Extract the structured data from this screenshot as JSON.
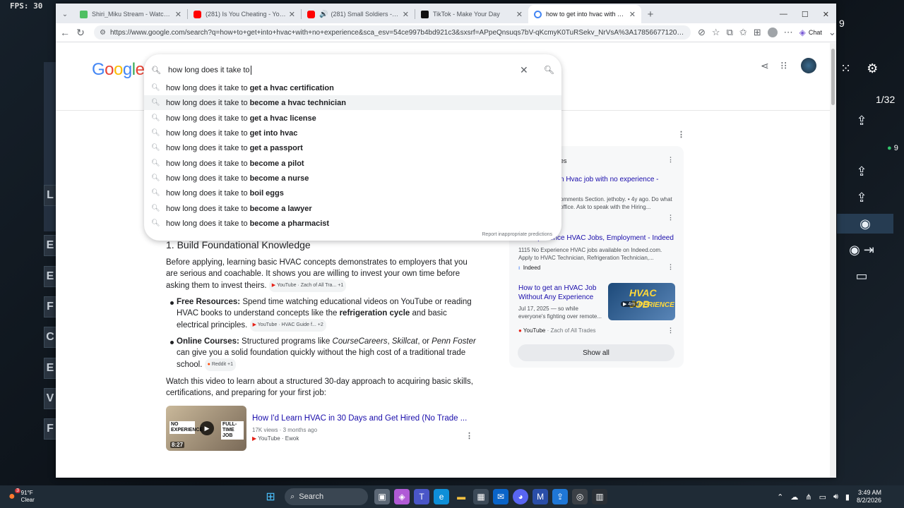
{
  "overlay": {
    "fps_label": "FPS:",
    "fps_value": "30"
  },
  "desktop": {
    "left_tiles": [
      "L",
      "E",
      "E",
      "F",
      "C",
      "E",
      "V",
      "F"
    ],
    "right_counter": "1/32",
    "right_badge": "9",
    "top_right_num": "9"
  },
  "browser": {
    "tabs": [
      {
        "title": "Shiri_Miku Stream - Watch Live on",
        "color": "#4fbf62"
      },
      {
        "title": "(281) Is You Cheating - YouTube",
        "color": "#ff0000"
      },
      {
        "title": "(281) Small Soldiers - YouTube",
        "color": "#ff0000"
      },
      {
        "title": "TikTok - Make Your Day",
        "color": "#111111"
      },
      {
        "title": "how to get into hvac with no expe",
        "color": "#4285f4"
      }
    ],
    "url": "https://www.google.com/search?q=how+to+get+into+hvac+with+no+experience&sca_esv=54ce997b4bd921c3&sxsrf=APpeQnsuqs7bV-qKcmyK0TuRSekv_NrVsA%3A1785667712096&ei=gCBvatK...",
    "chat_label": "Chat"
  },
  "google": {
    "logo": "Google",
    "query": "how long does it take to",
    "prefix": "how long does it take to",
    "suggestions": [
      "get a hvac certification",
      "become a hvac technician",
      "get a hvac license",
      "get into hvac",
      "get a passport",
      "become a pilot",
      "become a nurse",
      "boil eggs",
      "become a lawyer",
      "become a pharmacist"
    ],
    "report": "Report inappropriate predictions"
  },
  "content": {
    "section_heading": "1. Build Foundational Knowledge",
    "intro": "Before applying, learning basic HVAC concepts demonstrates to employers that you are serious and coachable. It shows you are willing to invest your own time before asking them to invest theirs.",
    "intro_cite": "YouTube · Zach of All Tra...",
    "intro_cite_more": "+1",
    "b1_title": "Free Resources:",
    "b1_text_a": "Spend time watching educational videos on YouTube or reading HVAC books to understand concepts like the",
    "b1_bold": "refrigeration cycle",
    "b1_text_b": "and basic electrical principles.",
    "b1_cite": "YouTube · HVAC Guide f...",
    "b1_cite_more": "+2",
    "b2_title": "Online Courses:",
    "b2_text_a": "Structured programs like",
    "b2_i1": "CourseCareers",
    "b2_i2": "Skillcat",
    "b2_or": ", or",
    "b2_i3": "Penn Foster",
    "b2_text_b": "can give you a solid foundation quickly without the high cost of a traditional trade school.",
    "b2_cite": "Reddit",
    "b2_cite_more": "+1",
    "video_intro": "Watch this video to learn about a structured 30-day approach to acquiring basic skills, certifications, and preparing for your first job:",
    "video": {
      "title": "How I'd Learn HVAC in 30 Days and Get Hired (No Trade ...",
      "meta": "17K views · 3 months ago",
      "source": "YouTube · Ewok",
      "duration": "8:27",
      "thumb_left": "NO EXPERIENCE",
      "thumb_right": "FULL-TIME JOB"
    }
  },
  "panel": {
    "header_partial": "es",
    "item1_title": "n Hvac job with no experience -",
    "item1_snip1": "omments Section. jethoby. • 4y ago. Do what",
    "item1_snip2": "office. Ask to speak with the Hiring...",
    "item2_title": "No Experience HVAC Jobs, Employment - Indeed",
    "item2_snip1": "1115 No Experience HVAC jobs available on Indeed.com.",
    "item2_snip2": "Apply to HVAC Technician, Refrigeration Technician,...",
    "item2_source": "Indeed",
    "item3_title_1": "How to get an HVAC Job",
    "item3_title_2": "Without Any Experience",
    "item3_snip1": "Jul 17, 2025 — so while",
    "item3_snip2": "everyone's fighting over remote...",
    "item3_source": "YouTube",
    "item3_author": "Zach of All Trades",
    "item3_thumb_1": "HVAC JOB",
    "item3_thumb_2": "XPERIENCE",
    "item3_duration": "4m",
    "show_all": "Show all"
  },
  "taskbar": {
    "weather_temp": "91°F",
    "weather_desc": "Clear",
    "weather_badge": "3",
    "search_label": "Search",
    "time": "3:49 AM",
    "date": "8/2/2026"
  }
}
